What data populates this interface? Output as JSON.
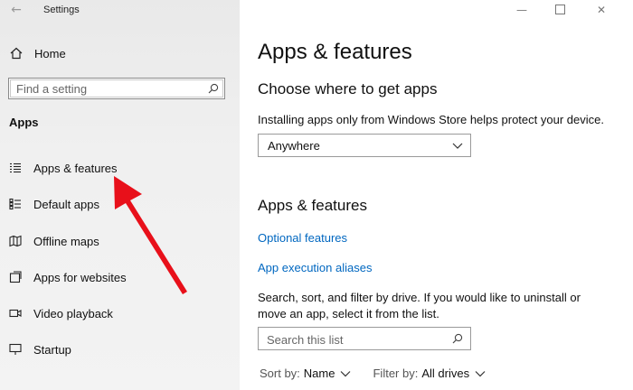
{
  "window": {
    "title": "Settings"
  },
  "sidebar": {
    "home_label": "Home",
    "search_placeholder": "Find a setting",
    "group_title": "Apps",
    "items": [
      {
        "label": "Apps & features",
        "icon": "list-icon"
      },
      {
        "label": "Default apps",
        "icon": "default-apps-icon"
      },
      {
        "label": "Offline maps",
        "icon": "map-icon"
      },
      {
        "label": "Apps for websites",
        "icon": "apps-for-websites-icon"
      },
      {
        "label": "Video playback",
        "icon": "video-icon"
      },
      {
        "label": "Startup",
        "icon": "startup-icon"
      }
    ]
  },
  "main": {
    "title": "Apps & features",
    "choose_heading": "Choose where to get apps",
    "store_text": "Installing apps only from Windows Store helps protect your device.",
    "source_dropdown_value": "Anywhere",
    "section_heading": "Apps & features",
    "links": {
      "optional_features": "Optional features",
      "app_execution_aliases": "App execution aliases"
    },
    "search_text": "Search, sort, and filter by drive. If you would like to uninstall or move an app, select it from the list.",
    "search_placeholder": "Search this list",
    "sort_label": "Sort by:",
    "sort_value": "Name",
    "filter_label": "Filter by:",
    "filter_value": "All drives"
  },
  "colors": {
    "link": "#0067c0",
    "annotation_arrow": "#e8101a"
  }
}
